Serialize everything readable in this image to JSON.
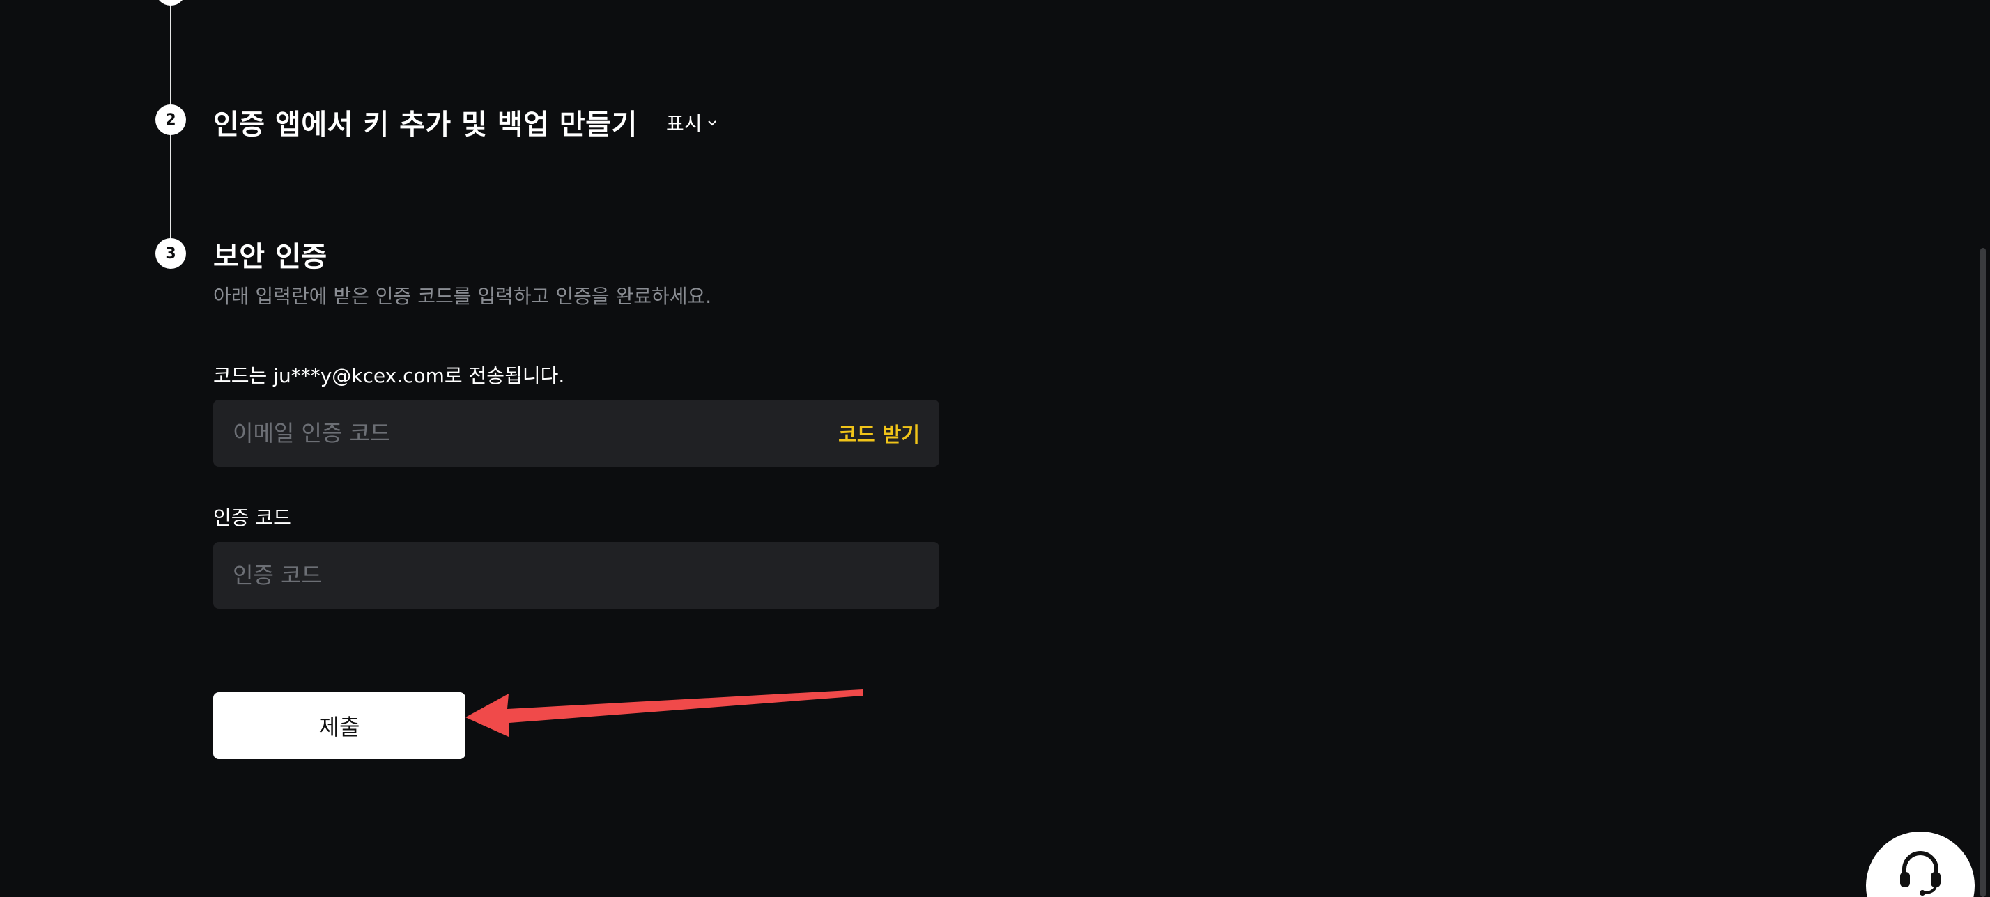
{
  "steps": [
    {
      "number": "2",
      "title": "인증 앱에서 키 추가 및 백업 만들기",
      "toggle_label": "표시"
    },
    {
      "number": "3",
      "title": "보안 인증",
      "description": "아래 입력란에 받은 인증 코드를 입력하고 인증을 완료하세요."
    }
  ],
  "email_section": {
    "label": "코드는 ju***y@kcex.com로 전송됩니다.",
    "placeholder": "이메일 인증 코드",
    "get_code_label": "코드 받기",
    "value": ""
  },
  "auth_section": {
    "label": "인증 코드",
    "placeholder": "인증 코드",
    "value": ""
  },
  "submit_label": "제출",
  "annotation": {
    "color": "#f04a4a"
  },
  "icons": {
    "toggle": "chevron-down-icon",
    "support": "headset-icon"
  }
}
